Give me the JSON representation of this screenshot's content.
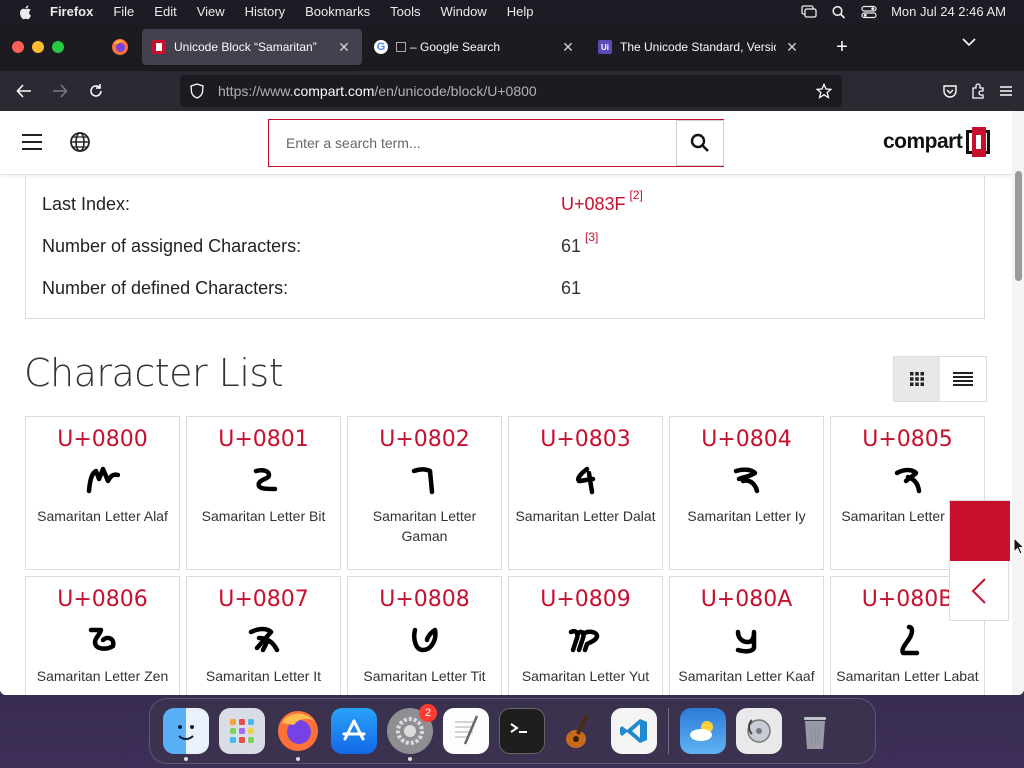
{
  "menubar": {
    "app": "Firefox",
    "items": [
      "File",
      "Edit",
      "View",
      "History",
      "Bookmarks",
      "Tools",
      "Window",
      "Help"
    ],
    "clock": "Mon Jul 24  2:46 AM"
  },
  "tabs": [
    {
      "title": "Unicode Block “Samaritan”",
      "favicon": "compart-favicon",
      "active": true
    },
    {
      "title": "– Google Search",
      "favicon": "google-favicon",
      "active": false
    },
    {
      "title": "The Unicode Standard, Version",
      "favicon": "unicode-favicon",
      "active": false
    }
  ],
  "urlbar": {
    "prefix": "https://www.",
    "host": "compart.com",
    "path": "/en/unicode/block/U+0800"
  },
  "site": {
    "search_placeholder": "Enter a search term...",
    "logo_text": "compart"
  },
  "info": [
    {
      "label": "Last Index:",
      "value": "U+083F",
      "ref": "[2]",
      "link": true
    },
    {
      "label": "Number of assigned Characters:",
      "value": "61",
      "ref": "[3]",
      "link": false
    },
    {
      "label": "Number of defined Characters:",
      "value": "61",
      "ref": "",
      "link": false
    }
  ],
  "section_title": "Character List",
  "characters": [
    {
      "code": "U+0800",
      "glyph": "ࠀ",
      "name": "Samaritan Letter Alaf"
    },
    {
      "code": "U+0801",
      "glyph": "ࠁ",
      "name": "Samaritan Letter Bit"
    },
    {
      "code": "U+0802",
      "glyph": "ࠂ",
      "name": "Samaritan Letter Gaman"
    },
    {
      "code": "U+0803",
      "glyph": "ࠃ",
      "name": "Samaritan Letter Dalat"
    },
    {
      "code": "U+0804",
      "glyph": "ࠄ",
      "name": "Samaritan Letter Iy"
    },
    {
      "code": "U+0805",
      "glyph": "ࠅ",
      "name": "Samaritan Letter Baa"
    },
    {
      "code": "U+0806",
      "glyph": "ࠆ",
      "name": "Samaritan Letter Zen"
    },
    {
      "code": "U+0807",
      "glyph": "ࠇ",
      "name": "Samaritan Letter It"
    },
    {
      "code": "U+0808",
      "glyph": "ࠈ",
      "name": "Samaritan Letter Tit"
    },
    {
      "code": "U+0809",
      "glyph": "ࠉ",
      "name": "Samaritan Letter Yut"
    },
    {
      "code": "U+080A",
      "glyph": "ࠊ",
      "name": "Samaritan Letter Kaaf"
    },
    {
      "code": "U+080B",
      "glyph": "ࠋ",
      "name": "Samaritan Letter Labat"
    }
  ],
  "dock": {
    "items": [
      "finder",
      "launchpad",
      "firefox",
      "app-store",
      "system-settings",
      "textedit",
      "terminal",
      "garageband",
      "vscode",
      "weather",
      "disk-utility",
      "trash"
    ],
    "settings_badge": "2"
  },
  "colors": {
    "accent": "#c8102e",
    "chrome_dark": "#1c1b22"
  }
}
